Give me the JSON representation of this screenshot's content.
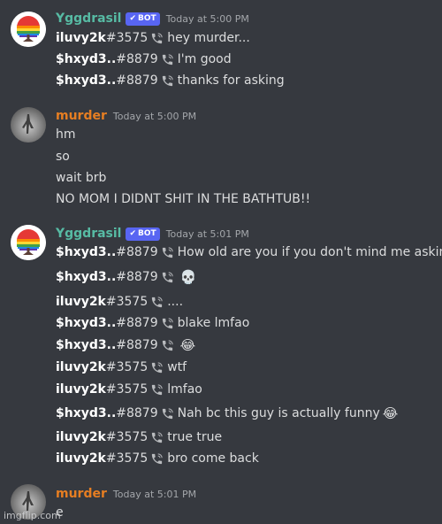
{
  "groups": [
    {
      "author": "Yggdrasil",
      "bot_tag": "BOT",
      "time": "Today at 5:00 PM",
      "lines": [
        {
          "user": "iluvy2k",
          "tag": "#3575",
          "text": "hey murder..."
        },
        {
          "user": "$hxyd3..",
          "tag": "#8879",
          "text": "I'm good"
        },
        {
          "user": "$hxyd3..",
          "tag": "#8879",
          "text": "thanks for asking"
        }
      ]
    },
    {
      "author": "murder",
      "time": "Today at 5:00 PM",
      "lines": [
        "hm",
        "so",
        "wait brb",
        "NO MOM I DIDNT SHIT IN THE BATHTUB!!"
      ]
    },
    {
      "author": "Yggdrasil",
      "bot_tag": "BOT",
      "time": "Today at 5:01 PM",
      "lines": [
        {
          "user": "$hxyd3..",
          "tag": "#8879",
          "text": "How old are you if you don't mind me asking?"
        },
        {
          "user": "$hxyd3..",
          "tag": "#8879",
          "text": "",
          "emoji": "💀"
        },
        {
          "user": "iluvy2k",
          "tag": "#3575",
          "text": "...."
        },
        {
          "user": "$hxyd3..",
          "tag": "#8879",
          "text": "blake lmfao"
        },
        {
          "user": "$hxyd3..",
          "tag": "#8879",
          "text": "",
          "emoji": "😂"
        },
        {
          "user": "iluvy2k",
          "tag": "#3575",
          "text": "wtf"
        },
        {
          "user": "iluvy2k",
          "tag": "#3575",
          "text": "lmfao"
        },
        {
          "user": "$hxyd3..",
          "tag": "#8879",
          "text": "Nah bc this guy is actually funny",
          "emoji": "😂"
        },
        {
          "user": "iluvy2k",
          "tag": "#3575",
          "text": "true true"
        },
        {
          "user": "iluvy2k",
          "tag": "#3575",
          "text": "bro come back"
        }
      ]
    },
    {
      "author": "murder",
      "time": "Today at 5:01 PM",
      "lines": [
        "e"
      ]
    }
  ],
  "watermark": "imgflip.com",
  "colors": {
    "background": "#36393f",
    "bot_name": "#57bba4",
    "user_name": "#e67e22",
    "bot_tag": "#5865f2"
  }
}
